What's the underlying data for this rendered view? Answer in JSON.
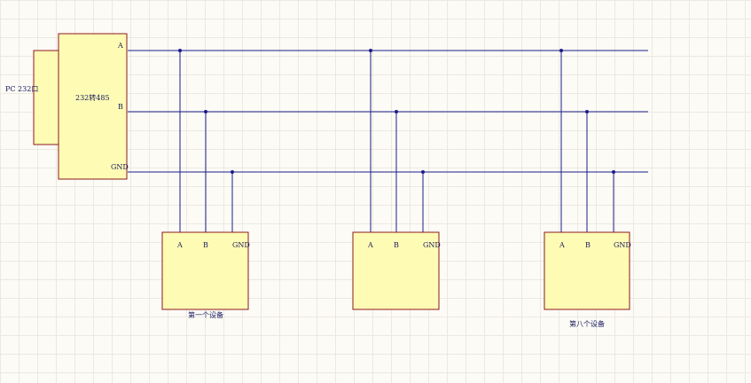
{
  "diagram": {
    "pc": {
      "label": "PC 232口"
    },
    "converter": {
      "label": "232转485",
      "pins": [
        "A",
        "B",
        "GND"
      ]
    },
    "devices": [
      {
        "pins": [
          "A",
          "B",
          "GND"
        ],
        "caption": "第一个设备"
      },
      {
        "pins": [
          "A",
          "B",
          "GND"
        ],
        "caption": ""
      },
      {
        "pins": [
          "A",
          "B",
          "GND"
        ],
        "caption": "第八个设备"
      }
    ],
    "bus_lines": [
      "A",
      "B",
      "GND"
    ],
    "colors": {
      "wire": "#1c1c8a",
      "box_fill": "#fefcb4",
      "box_stroke": "#8b1a1a",
      "junction": "#1c1c8a"
    }
  }
}
